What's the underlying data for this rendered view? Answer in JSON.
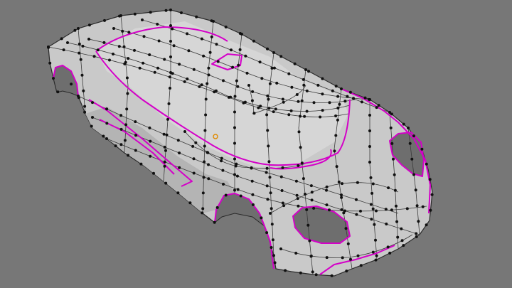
{
  "viewport": {
    "background_color": "#777777",
    "object": {
      "type": "car-body-mesh",
      "surface_color": "#c9c9c9",
      "wire_color": "#3a3a3a",
      "vertex_color": "#111111",
      "seam_color": "#d400c8",
      "origin_color": "#e08a00"
    }
  }
}
